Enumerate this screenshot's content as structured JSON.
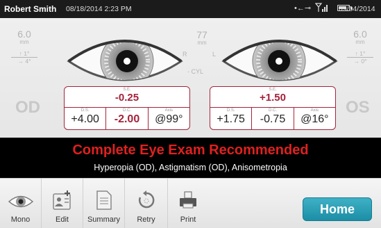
{
  "status_bar": {
    "user": "Robert Smith",
    "datetime": "08/18/2014 2:23 PM",
    "date_right": "09/04/2014",
    "icons": [
      "usb-icon",
      "signal-icon",
      "battery-icon"
    ]
  },
  "left": {
    "pd_value": "6.0",
    "pd_unit": "mm",
    "tilt_top": "↑ 1°",
    "tilt_bottom": "→ 4°",
    "eye_label": "OD",
    "letter": "R"
  },
  "right": {
    "pd_value": "6.0",
    "pd_unit": "mm",
    "tilt_top": "↑ 1°",
    "tilt_bottom": "→ 0°",
    "eye_label": "OS",
    "letter": "L"
  },
  "center": {
    "distance_value": "77",
    "distance_unit": "mm",
    "cyl_label": "- CYL"
  },
  "od_result": {
    "se_label": "S.E.",
    "se_value": "-0.25",
    "ds_label": "D.S.",
    "ds_value": "+4.00",
    "dc_label": "D.C.",
    "dc_value": "-2.00",
    "axis_label": "Axis",
    "axis_value": "@99°"
  },
  "os_result": {
    "se_label": "S.E.",
    "se_value": "+1.50",
    "ds_label": "D.S.",
    "ds_value": "+1.75",
    "dc_label": "D.C.",
    "dc_value": "-0.75",
    "axis_label": "Axis",
    "axis_value": "@16°"
  },
  "banner": {
    "title": "Complete Eye Exam Recommended",
    "subtitle": "Hyperopia (OD),  Astigmatism (OD),  Anisometropia"
  },
  "toolbar": {
    "mono": "Mono",
    "edit": "Edit",
    "summary": "Summary",
    "retry": "Retry",
    "print": "Print",
    "home": "Home"
  },
  "colors": {
    "accent_red": "#a3233a",
    "banner_red": "#e02020",
    "home_blue": "#2a9fb6"
  }
}
